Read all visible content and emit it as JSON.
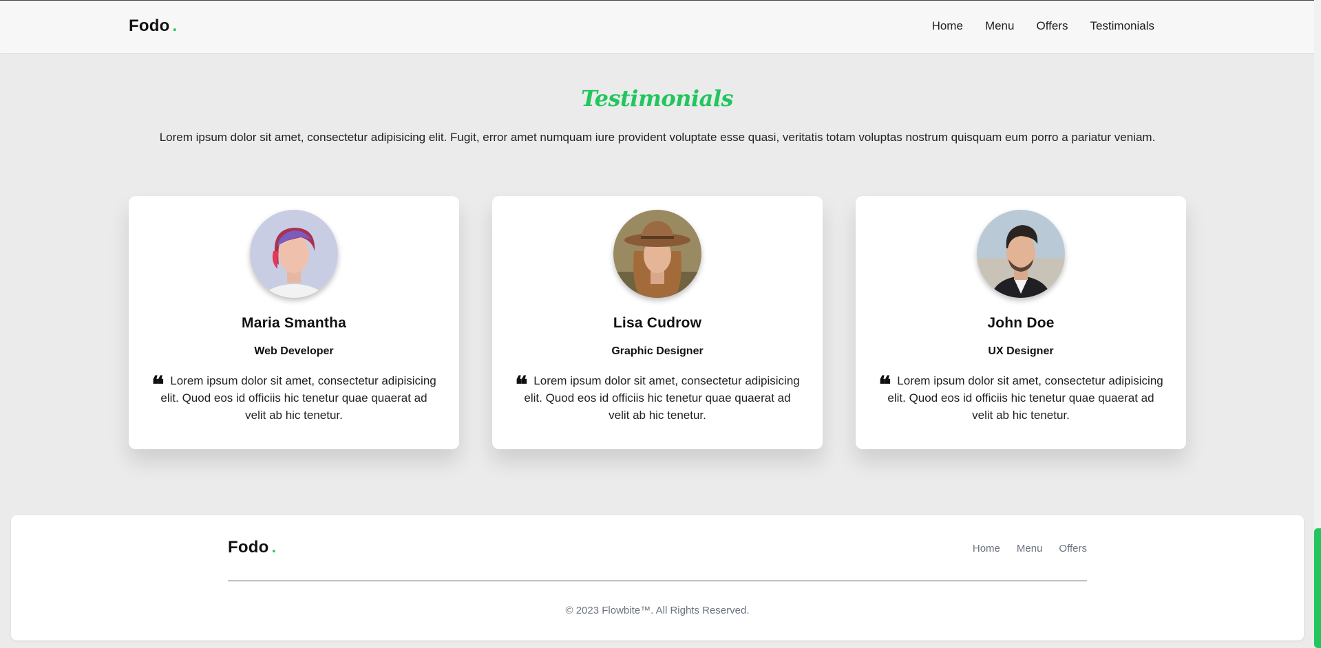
{
  "header": {
    "logo_text": "Fodo",
    "logo_dot": ".",
    "nav": [
      "Home",
      "Menu",
      "Offers",
      "Testimonials"
    ]
  },
  "section": {
    "title": "Testimonials",
    "description": "Lorem ipsum dolor sit amet, consectetur adipisicing elit. Fugit, error amet numquam iure provident voluptate esse quasi, veritatis totam voluptas nostrum quisquam eum porro a pariatur veniam."
  },
  "testimonials": [
    {
      "name": "Maria Smantha",
      "role": "Web Developer",
      "quote": "Lorem ipsum dolor sit amet, consectetur adipisicing elit. Quod eos id officiis hic tenetur quae quaerat ad velit ab hic tenetur."
    },
    {
      "name": "Lisa Cudrow",
      "role": "Graphic Designer",
      "quote": "Lorem ipsum dolor sit amet, consectetur adipisicing elit. Quod eos id officiis hic tenetur quae quaerat ad velit ab hic tenetur."
    },
    {
      "name": "John Doe",
      "role": "UX Designer",
      "quote": "Lorem ipsum dolor sit amet, consectetur adipisicing elit. Quod eos id officiis hic tenetur quae quaerat ad velit ab hic tenetur."
    }
  ],
  "footer": {
    "logo_text": "Fodo",
    "logo_dot": ".",
    "nav": [
      "Home",
      "Menu",
      "Offers"
    ],
    "copyright": "© 2023 Flowbite™. All Rights Reserved."
  },
  "icons": {
    "quote": "quote-open-icon",
    "quote_glyph": "❝"
  },
  "colors": {
    "accent": "#22c55e",
    "background": "#eaebea",
    "card": "#ffffff",
    "muted_text": "#6b7280"
  }
}
